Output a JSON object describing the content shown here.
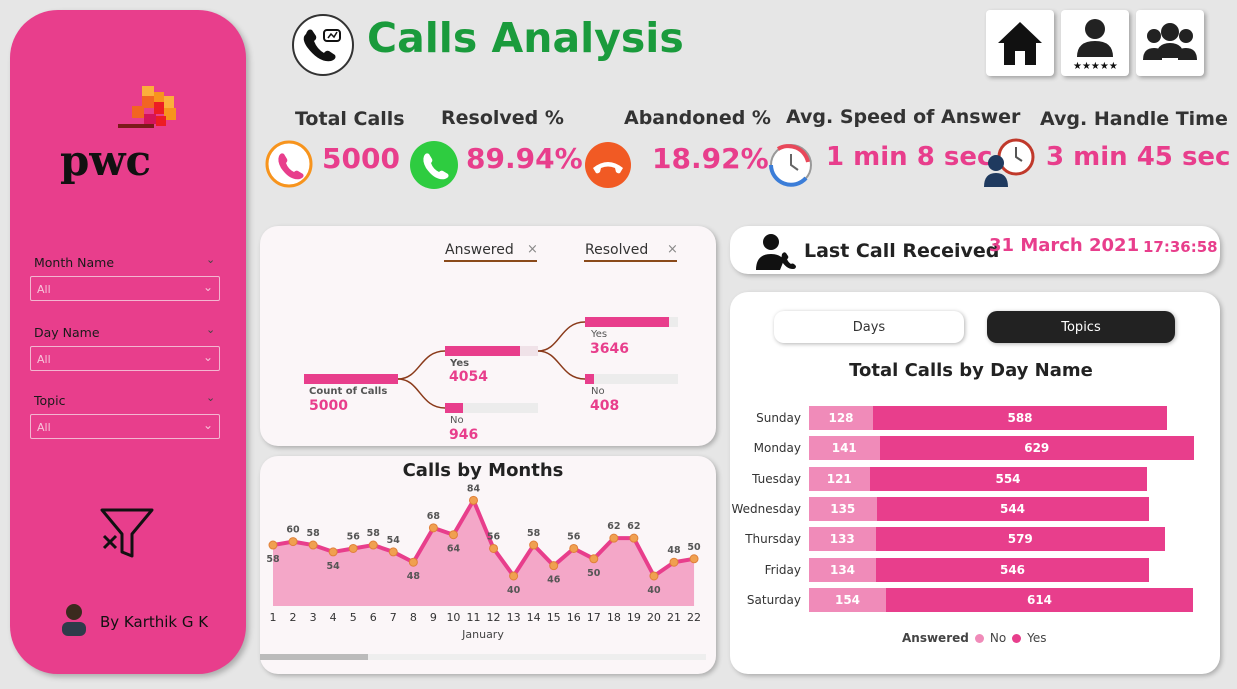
{
  "header": {
    "title": "Calls Analysis"
  },
  "nav": {
    "home_icon": "home-icon",
    "rating_icon": "agent-rating-icon",
    "team_icon": "team-icon"
  },
  "sidebar": {
    "logo_text": "pwc",
    "slicers": [
      {
        "label": "Month Name",
        "value": "All"
      },
      {
        "label": "Day Name",
        "value": "All"
      },
      {
        "label": "Topic",
        "value": "All"
      }
    ],
    "author": "By Karthik G K"
  },
  "kpis": [
    {
      "title": "Total Calls",
      "value": "5000"
    },
    {
      "title": "Resolved %",
      "value": "89.94%"
    },
    {
      "title": "Abandoned %",
      "value": "18.92%"
    },
    {
      "title": "Avg. Speed of Answer",
      "value": "1 min 8 sec"
    },
    {
      "title": "Avg. Handle Time",
      "value": "3 min 45 sec"
    }
  ],
  "last_call": {
    "label": "Last Call Received",
    "date": "31 March 2021",
    "time": "17:36:58"
  },
  "decomposition": {
    "filters": [
      "Answered",
      "Resolved"
    ],
    "root": {
      "label": "Count of Calls",
      "value": "5000"
    },
    "answered": [
      {
        "label": "Yes",
        "value": "4054"
      },
      {
        "label": "No",
        "value": "946"
      }
    ],
    "resolved": [
      {
        "label": "Yes",
        "value": "3646"
      },
      {
        "label": "No",
        "value": "408"
      }
    ]
  },
  "tabs": {
    "days": "Days",
    "topics": "Topics"
  },
  "colors": {
    "pink": "#e83e8c",
    "light_pink": "#f08bb9",
    "green": "#1a9b3c"
  },
  "chart_data": [
    {
      "type": "area",
      "title": "Calls by Months",
      "xlabel": "January",
      "x": [
        1,
        2,
        3,
        4,
        5,
        6,
        7,
        8,
        9,
        10,
        11,
        12,
        13,
        14,
        15,
        16,
        17,
        18,
        19,
        20,
        21,
        22
      ],
      "values": [
        58,
        60,
        58,
        54,
        56,
        58,
        54,
        48,
        68,
        64,
        84,
        56,
        40,
        58,
        46,
        56,
        50,
        62,
        62,
        40,
        48,
        50
      ]
    },
    {
      "type": "bar",
      "title": "Total Calls by Day Name",
      "categories": [
        "Sunday",
        "Monday",
        "Tuesday",
        "Wednesday",
        "Thursday",
        "Friday",
        "Saturday"
      ],
      "series": [
        {
          "name": "No",
          "values": [
            128,
            141,
            121,
            135,
            133,
            134,
            154
          ]
        },
        {
          "name": "Yes",
          "values": [
            588,
            629,
            554,
            544,
            579,
            546,
            614
          ]
        }
      ],
      "legend_title": "Answered",
      "legend": "bottom"
    }
  ]
}
